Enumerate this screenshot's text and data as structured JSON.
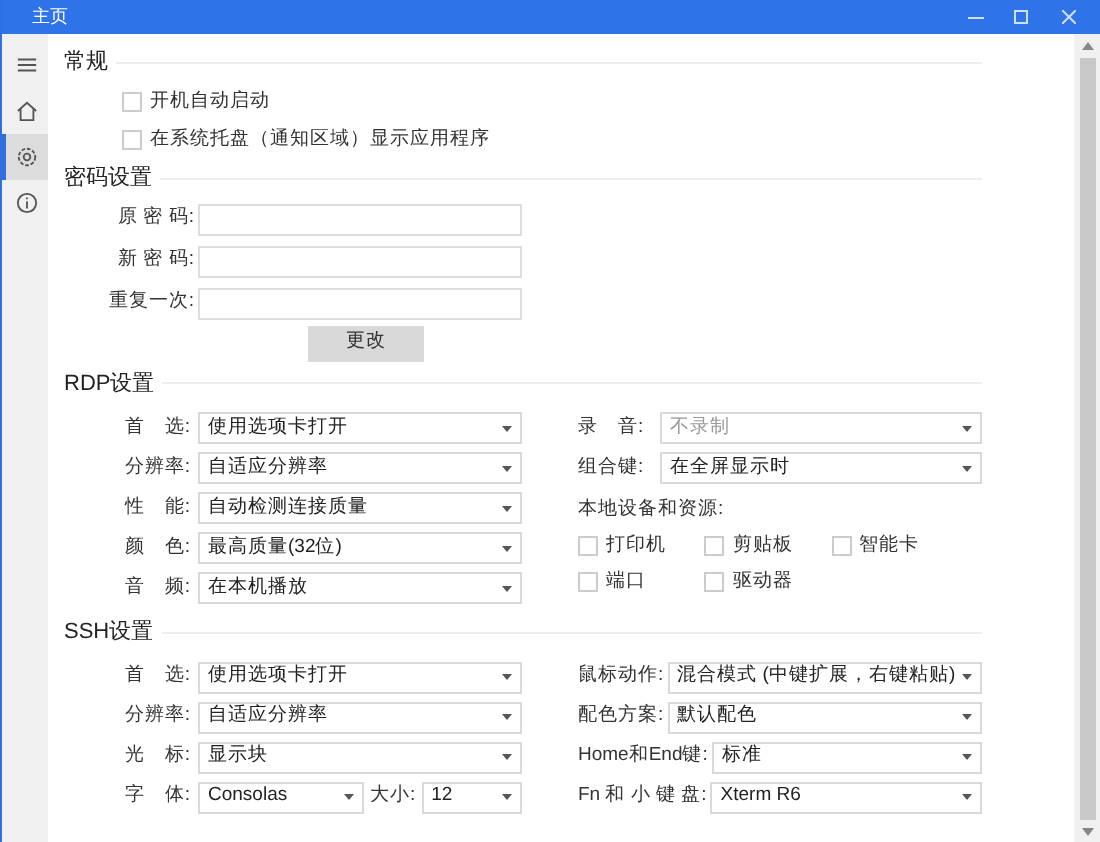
{
  "window": {
    "title": "主页"
  },
  "sidebar": {
    "items": [
      {
        "kind": "menu",
        "selected": false
      },
      {
        "kind": "home",
        "selected": false
      },
      {
        "kind": "settings",
        "selected": true
      },
      {
        "kind": "info",
        "selected": false
      }
    ]
  },
  "general": {
    "title": "常规",
    "checkboxes": [
      {
        "label": "开机自动启动",
        "checked": false
      },
      {
        "label": "在系统托盘（通知区域）显示应用程序",
        "checked": false
      }
    ]
  },
  "password": {
    "title": "密码设置",
    "fields": [
      {
        "label": "原 密 码:"
      },
      {
        "label": "新 密 码:"
      },
      {
        "label": "重复一次:"
      }
    ],
    "button": "更改"
  },
  "rdp": {
    "title": "RDP设置",
    "left": [
      {
        "label": "首　选:",
        "value": "使用选项卡打开"
      },
      {
        "label": "分辨率:",
        "value": "自适应分辨率"
      },
      {
        "label": "性　能:",
        "value": "自动检测连接质量"
      },
      {
        "label": "颜　色:",
        "value": "最高质量(32位)"
      },
      {
        "label": "音　频:",
        "value": "在本机播放"
      }
    ],
    "right": [
      {
        "label": "录　音:",
        "value": "不录制",
        "disabled": true
      },
      {
        "label": "组合键:",
        "value": "在全屏显示时",
        "disabled": false
      }
    ],
    "resources_label": "本地设备和资源:",
    "resources": [
      {
        "label": "打印机",
        "checked": false
      },
      {
        "label": "剪贴板",
        "checked": false
      },
      {
        "label": "智能卡",
        "checked": false
      },
      {
        "label": "端口",
        "checked": false
      },
      {
        "label": "驱动器",
        "checked": false
      }
    ]
  },
  "ssh": {
    "title": "SSH设置",
    "left": [
      {
        "kind": "select",
        "label": "首　选:",
        "value": "使用选项卡打开"
      },
      {
        "kind": "select",
        "label": "分辨率:",
        "value": "自适应分辨率"
      },
      {
        "kind": "select",
        "label": "光　标:",
        "value": "显示块"
      },
      {
        "kind": "font",
        "label": "字　体:",
        "value": "Consolas",
        "size_label": "大小:",
        "size": "12"
      }
    ],
    "right": [
      {
        "label": "鼠标动作:",
        "value": "混合模式 (中键扩展，右键粘贴)"
      },
      {
        "label": "配色方案:",
        "value": "默认配色"
      },
      {
        "label": "Home和End键:",
        "value": "标准"
      },
      {
        "label": "Fn 和 小 键 盘:",
        "value": "Xterm R6"
      }
    ]
  }
}
